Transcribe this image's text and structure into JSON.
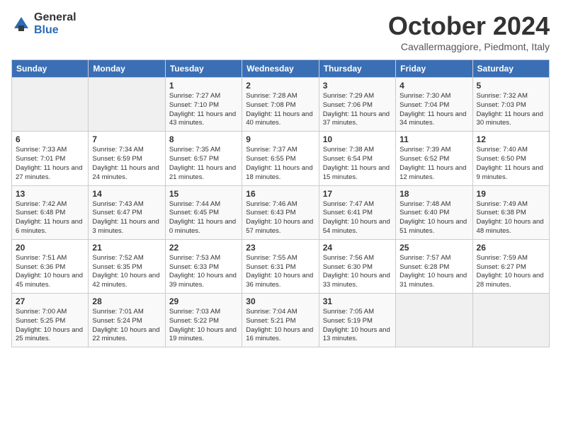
{
  "header": {
    "logo_general": "General",
    "logo_blue": "Blue",
    "month_title": "October 2024",
    "subtitle": "Cavallermaggiore, Piedmont, Italy"
  },
  "days_of_week": [
    "Sunday",
    "Monday",
    "Tuesday",
    "Wednesday",
    "Thursday",
    "Friday",
    "Saturday"
  ],
  "weeks": [
    [
      {
        "day": "",
        "info": ""
      },
      {
        "day": "",
        "info": ""
      },
      {
        "day": "1",
        "info": "Sunrise: 7:27 AM\nSunset: 7:10 PM\nDaylight: 11 hours and 43 minutes."
      },
      {
        "day": "2",
        "info": "Sunrise: 7:28 AM\nSunset: 7:08 PM\nDaylight: 11 hours and 40 minutes."
      },
      {
        "day": "3",
        "info": "Sunrise: 7:29 AM\nSunset: 7:06 PM\nDaylight: 11 hours and 37 minutes."
      },
      {
        "day": "4",
        "info": "Sunrise: 7:30 AM\nSunset: 7:04 PM\nDaylight: 11 hours and 34 minutes."
      },
      {
        "day": "5",
        "info": "Sunrise: 7:32 AM\nSunset: 7:03 PM\nDaylight: 11 hours and 30 minutes."
      }
    ],
    [
      {
        "day": "6",
        "info": "Sunrise: 7:33 AM\nSunset: 7:01 PM\nDaylight: 11 hours and 27 minutes."
      },
      {
        "day": "7",
        "info": "Sunrise: 7:34 AM\nSunset: 6:59 PM\nDaylight: 11 hours and 24 minutes."
      },
      {
        "day": "8",
        "info": "Sunrise: 7:35 AM\nSunset: 6:57 PM\nDaylight: 11 hours and 21 minutes."
      },
      {
        "day": "9",
        "info": "Sunrise: 7:37 AM\nSunset: 6:55 PM\nDaylight: 11 hours and 18 minutes."
      },
      {
        "day": "10",
        "info": "Sunrise: 7:38 AM\nSunset: 6:54 PM\nDaylight: 11 hours and 15 minutes."
      },
      {
        "day": "11",
        "info": "Sunrise: 7:39 AM\nSunset: 6:52 PM\nDaylight: 11 hours and 12 minutes."
      },
      {
        "day": "12",
        "info": "Sunrise: 7:40 AM\nSunset: 6:50 PM\nDaylight: 11 hours and 9 minutes."
      }
    ],
    [
      {
        "day": "13",
        "info": "Sunrise: 7:42 AM\nSunset: 6:48 PM\nDaylight: 11 hours and 6 minutes."
      },
      {
        "day": "14",
        "info": "Sunrise: 7:43 AM\nSunset: 6:47 PM\nDaylight: 11 hours and 3 minutes."
      },
      {
        "day": "15",
        "info": "Sunrise: 7:44 AM\nSunset: 6:45 PM\nDaylight: 11 hours and 0 minutes."
      },
      {
        "day": "16",
        "info": "Sunrise: 7:46 AM\nSunset: 6:43 PM\nDaylight: 10 hours and 57 minutes."
      },
      {
        "day": "17",
        "info": "Sunrise: 7:47 AM\nSunset: 6:41 PM\nDaylight: 10 hours and 54 minutes."
      },
      {
        "day": "18",
        "info": "Sunrise: 7:48 AM\nSunset: 6:40 PM\nDaylight: 10 hours and 51 minutes."
      },
      {
        "day": "19",
        "info": "Sunrise: 7:49 AM\nSunset: 6:38 PM\nDaylight: 10 hours and 48 minutes."
      }
    ],
    [
      {
        "day": "20",
        "info": "Sunrise: 7:51 AM\nSunset: 6:36 PM\nDaylight: 10 hours and 45 minutes."
      },
      {
        "day": "21",
        "info": "Sunrise: 7:52 AM\nSunset: 6:35 PM\nDaylight: 10 hours and 42 minutes."
      },
      {
        "day": "22",
        "info": "Sunrise: 7:53 AM\nSunset: 6:33 PM\nDaylight: 10 hours and 39 minutes."
      },
      {
        "day": "23",
        "info": "Sunrise: 7:55 AM\nSunset: 6:31 PM\nDaylight: 10 hours and 36 minutes."
      },
      {
        "day": "24",
        "info": "Sunrise: 7:56 AM\nSunset: 6:30 PM\nDaylight: 10 hours and 33 minutes."
      },
      {
        "day": "25",
        "info": "Sunrise: 7:57 AM\nSunset: 6:28 PM\nDaylight: 10 hours and 31 minutes."
      },
      {
        "day": "26",
        "info": "Sunrise: 7:59 AM\nSunset: 6:27 PM\nDaylight: 10 hours and 28 minutes."
      }
    ],
    [
      {
        "day": "27",
        "info": "Sunrise: 7:00 AM\nSunset: 5:25 PM\nDaylight: 10 hours and 25 minutes."
      },
      {
        "day": "28",
        "info": "Sunrise: 7:01 AM\nSunset: 5:24 PM\nDaylight: 10 hours and 22 minutes."
      },
      {
        "day": "29",
        "info": "Sunrise: 7:03 AM\nSunset: 5:22 PM\nDaylight: 10 hours and 19 minutes."
      },
      {
        "day": "30",
        "info": "Sunrise: 7:04 AM\nSunset: 5:21 PM\nDaylight: 10 hours and 16 minutes."
      },
      {
        "day": "31",
        "info": "Sunrise: 7:05 AM\nSunset: 5:19 PM\nDaylight: 10 hours and 13 minutes."
      },
      {
        "day": "",
        "info": ""
      },
      {
        "day": "",
        "info": ""
      }
    ]
  ]
}
